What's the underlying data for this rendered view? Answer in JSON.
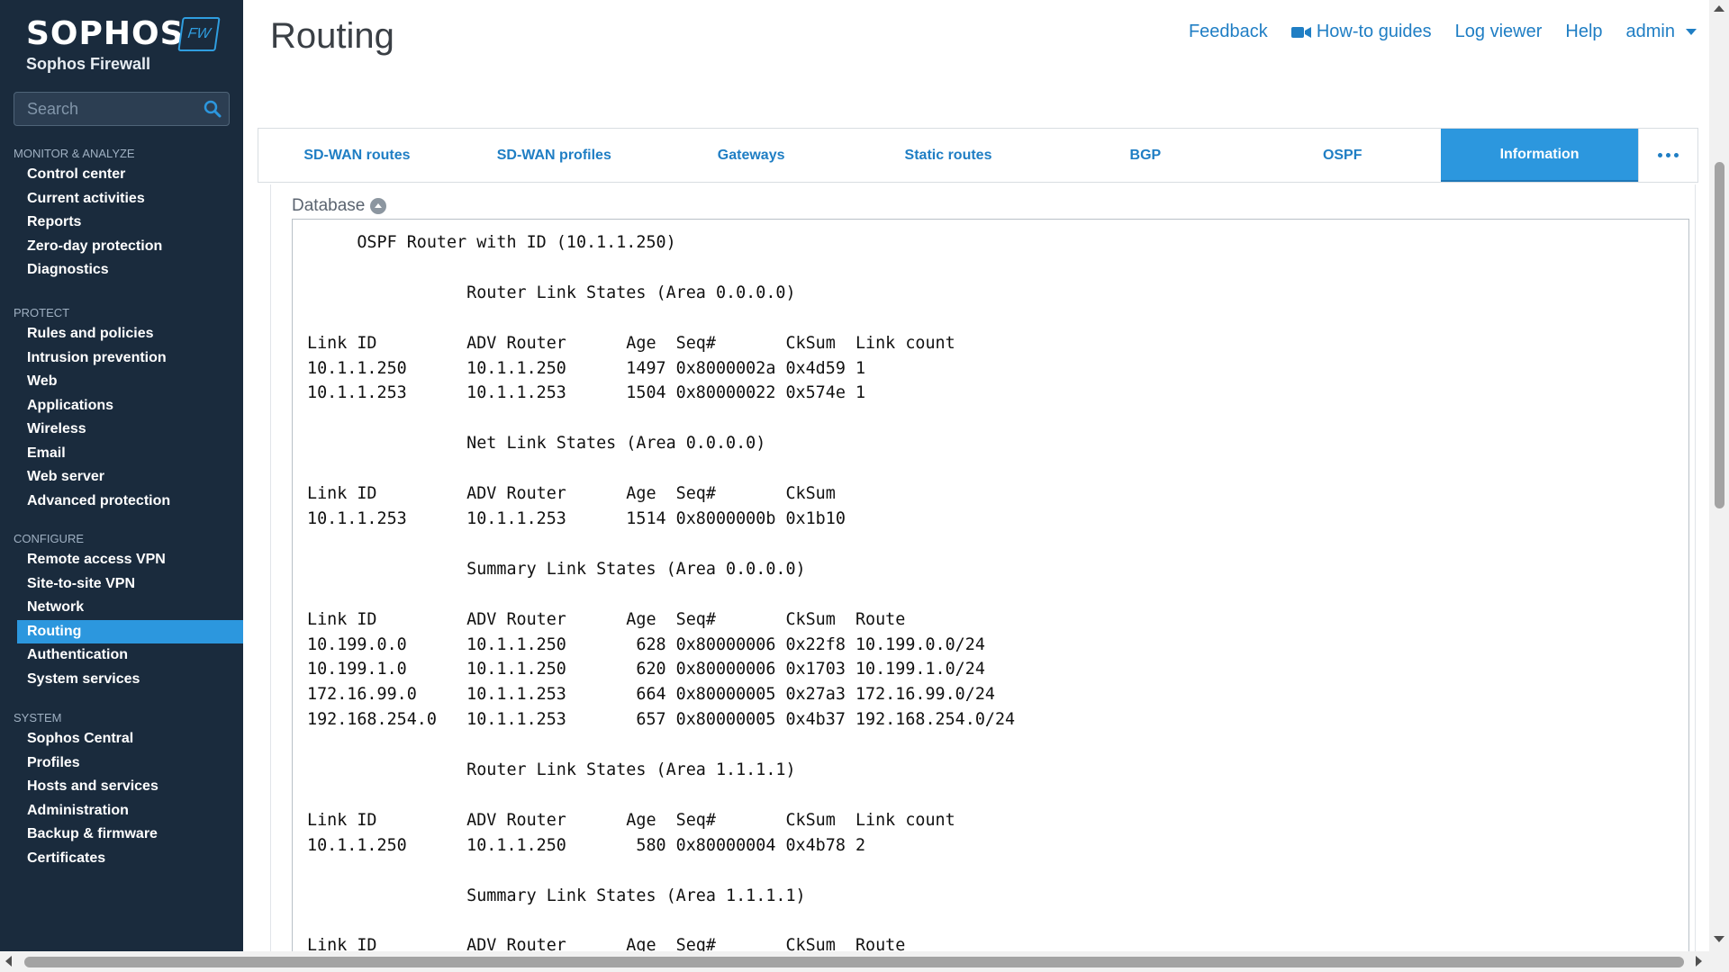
{
  "brand": {
    "name": "SOPHOS",
    "badge": "FW",
    "product": "Sophos Firewall"
  },
  "search": {
    "placeholder": "Search"
  },
  "nav": [
    {
      "heading": "MONITOR & ANALYZE",
      "items": [
        "Control center",
        "Current activities",
        "Reports",
        "Zero-day protection",
        "Diagnostics"
      ]
    },
    {
      "heading": "PROTECT",
      "items": [
        "Rules and policies",
        "Intrusion prevention",
        "Web",
        "Applications",
        "Wireless",
        "Email",
        "Web server",
        "Advanced protection"
      ]
    },
    {
      "heading": "CONFIGURE",
      "items": [
        "Remote access VPN",
        "Site-to-site VPN",
        "Network",
        "Routing",
        "Authentication",
        "System services"
      ]
    },
    {
      "heading": "SYSTEM",
      "items": [
        "Sophos Central",
        "Profiles",
        "Hosts and services",
        "Administration",
        "Backup & firmware",
        "Certificates"
      ]
    }
  ],
  "active_nav": "Routing",
  "header": {
    "title": "Routing",
    "links": {
      "feedback": "Feedback",
      "howto": "How-to guides",
      "logviewer": "Log viewer",
      "help": "Help",
      "user": "admin"
    }
  },
  "tabs": [
    "SD-WAN routes",
    "SD-WAN profiles",
    "Gateways",
    "Static routes",
    "BGP",
    "OSPF",
    "Information"
  ],
  "active_tab": "Information",
  "database": {
    "label": "Database",
    "lines": [
      "     OSPF Router with ID (10.1.1.250)",
      "",
      "                Router Link States (Area 0.0.0.0)",
      "",
      "Link ID         ADV Router      Age  Seq#       CkSum  Link count",
      "10.1.1.250      10.1.1.250      1497 0x8000002a 0x4d59 1",
      "10.1.1.253      10.1.1.253      1504 0x80000022 0x574e 1",
      "",
      "                Net Link States (Area 0.0.0.0)",
      "",
      "Link ID         ADV Router      Age  Seq#       CkSum",
      "10.1.1.253      10.1.1.253      1514 0x8000000b 0x1b10",
      "",
      "                Summary Link States (Area 0.0.0.0)",
      "",
      "Link ID         ADV Router      Age  Seq#       CkSum  Route",
      "10.199.0.0      10.1.1.250       628 0x80000006 0x22f8 10.199.0.0/24",
      "10.199.1.0      10.1.1.250       620 0x80000006 0x1703 10.199.1.0/24",
      "172.16.99.0     10.1.1.253       664 0x80000005 0x27a3 172.16.99.0/24",
      "192.168.254.0   10.1.1.253       657 0x80000005 0x4b37 192.168.254.0/24",
      "",
      "                Router Link States (Area 1.1.1.1)",
      "",
      "Link ID         ADV Router      Age  Seq#       CkSum  Link count",
      "10.1.1.250      10.1.1.250       580 0x80000004 0x4b78 2",
      "",
      "                Summary Link States (Area 1.1.1.1)",
      "",
      "Link ID         ADV Router      Age  Seq#       CkSum  Route"
    ]
  }
}
